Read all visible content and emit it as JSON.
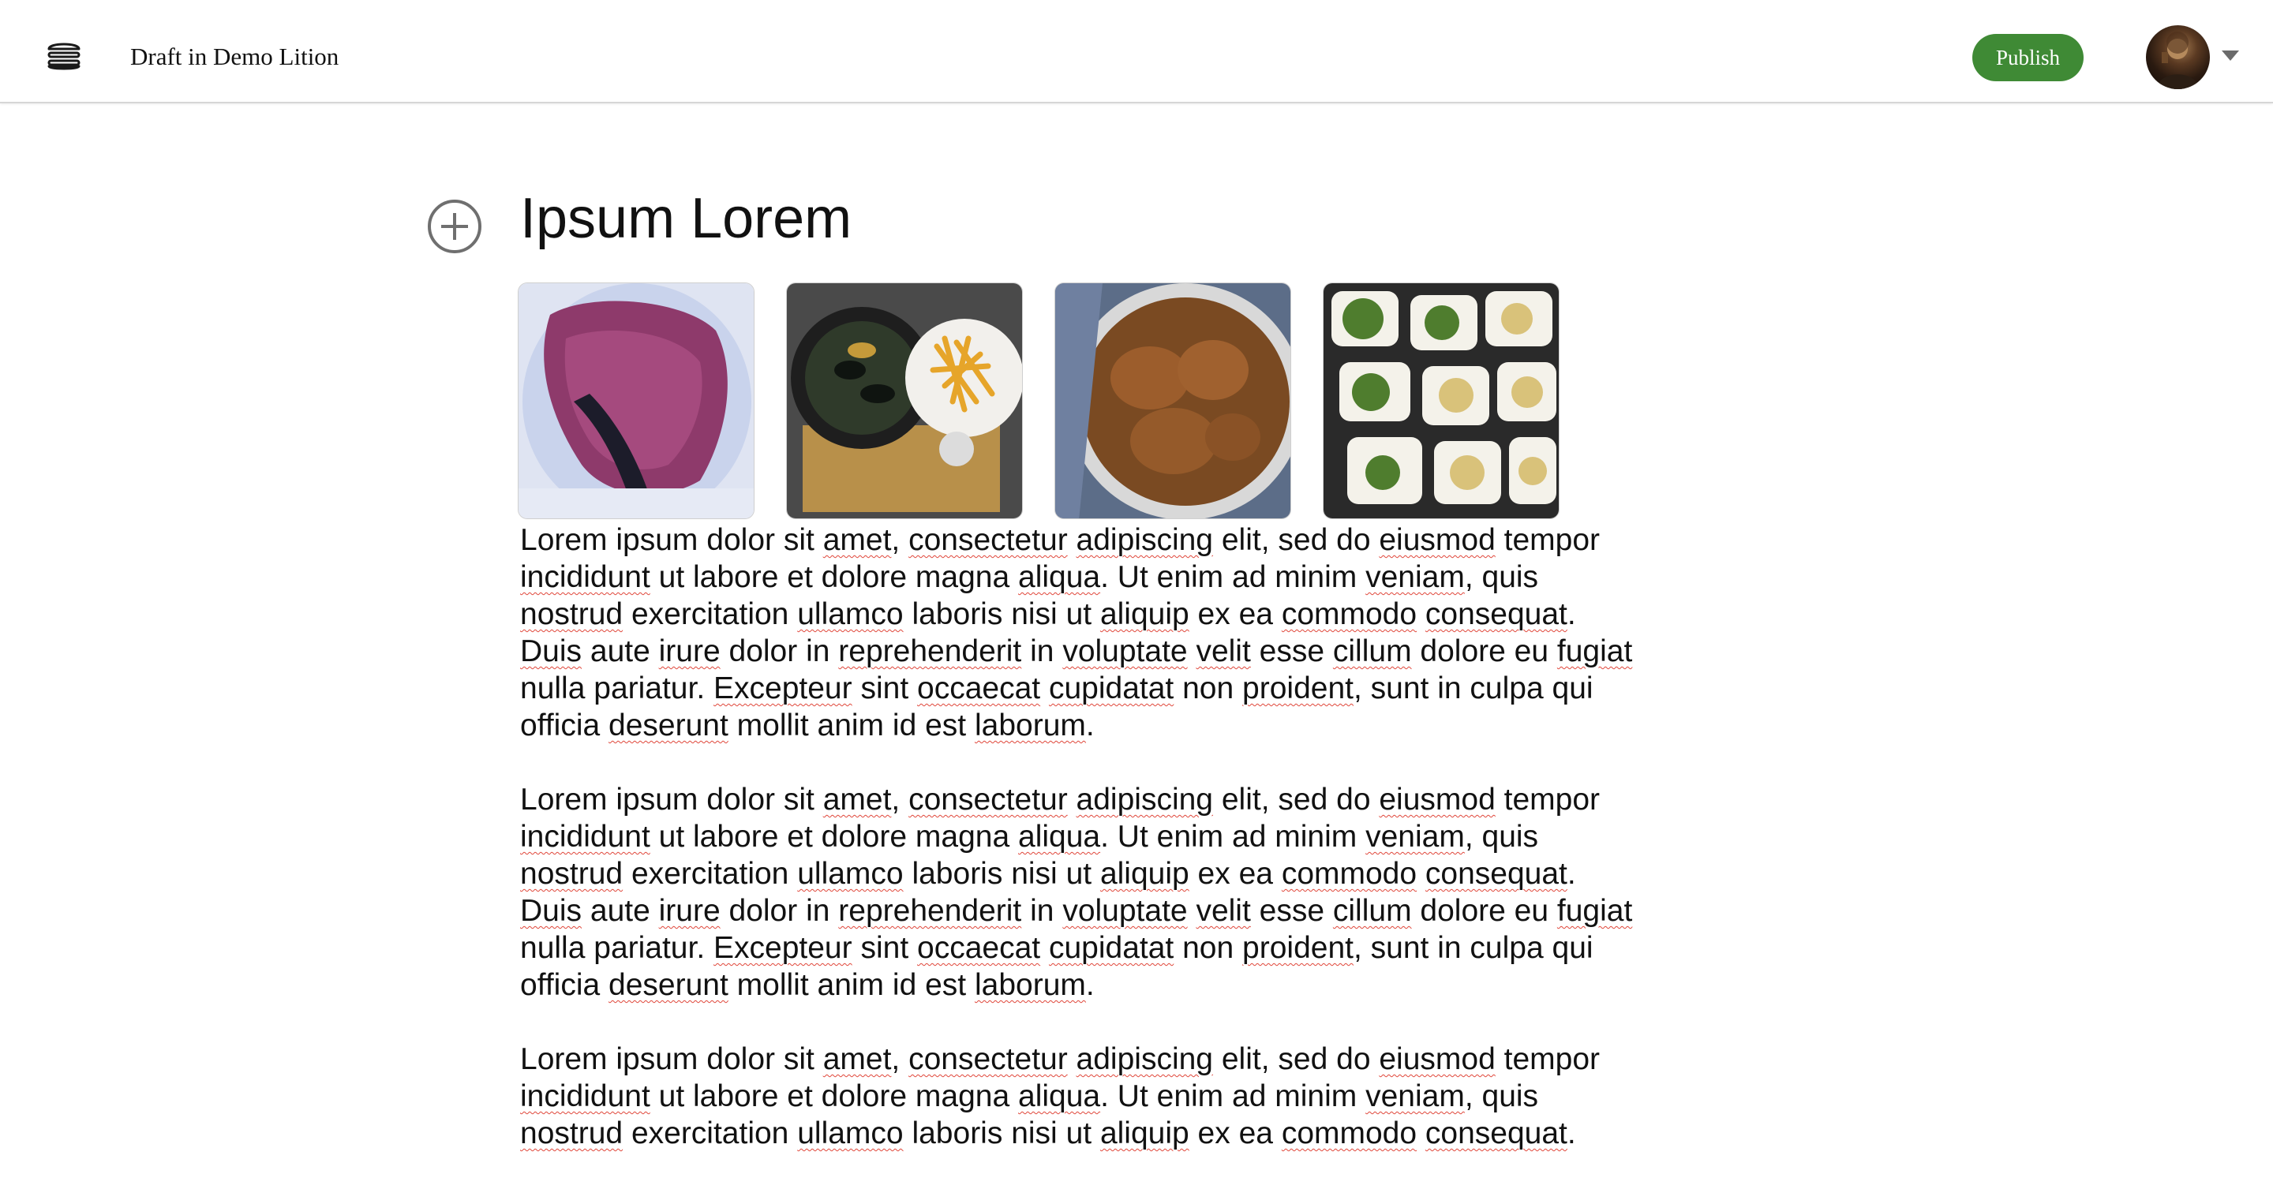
{
  "header": {
    "menu_icon": "hamburger-stack-icon",
    "document_title": "Draft in Demo Lition",
    "publish_label": "Publish",
    "avatar_icon": "user-avatar",
    "account_menu_icon": "caret-down-icon"
  },
  "editor": {
    "add_block_icon": "plus-circle-icon",
    "heading": "Ipsum Lorem",
    "gallery": [
      {
        "subject": "berry sorbet in glass"
      },
      {
        "subject": "mussels and fries"
      },
      {
        "subject": "braised chicken stew"
      },
      {
        "subject": "mezze salad bowls"
      }
    ],
    "paragraphs": [
      "Lorem ipsum dolor sit amet, consectetur adipiscing elit, sed do eiusmod tempor incididunt ut labore et dolore magna aliqua. Ut enim ad minim veniam, quis nostrud exercitation ullamco laboris nisi ut aliquip ex ea commodo consequat. Duis aute irure dolor in reprehenderit in voluptate velit esse cillum dolore eu fugiat nulla pariatur. Excepteur sint occaecat cupidatat non proident, sunt in culpa qui officia deserunt mollit anim id est laborum.",
      "Lorem ipsum dolor sit amet, consectetur adipiscing elit, sed do eiusmod tempor incididunt ut labore et dolore magna aliqua. Ut enim ad minim veniam, quis nostrud exercitation ullamco laboris nisi ut aliquip ex ea commodo consequat. Duis aute irure dolor in reprehenderit in voluptate velit esse cillum dolore eu fugiat nulla pariatur. Excepteur sint occaecat cupidatat non proident, sunt in culpa qui officia deserunt mollit anim id est laborum.",
      "Lorem ipsum dolor sit amet, consectetur adipiscing elit, sed do eiusmod tempor incididunt ut labore et dolore magna aliqua. Ut enim ad minim veniam, quis nostrud exercitation ullamco laboris nisi ut aliquip ex ea commodo consequat."
    ],
    "spellcheck_flagged_words": [
      "amet",
      "consectetur",
      "adipiscing",
      "eiusmod",
      "incididunt",
      "aliqua",
      "veniam",
      "nostrud",
      "ullamco",
      "aliquip",
      "commodo",
      "consequat",
      "Duis",
      "irure",
      "reprehenderit",
      "voluptate",
      "velit",
      "cillum",
      "fugiat",
      "Excepteur",
      "occaecat",
      "cupidatat",
      "proident",
      "deserunt",
      "laborum"
    ]
  },
  "colors": {
    "publish_button": "#3f8a35",
    "spellcheck_underline": "#e0463a",
    "header_border": "#d6d6d6",
    "text": "#111111"
  }
}
